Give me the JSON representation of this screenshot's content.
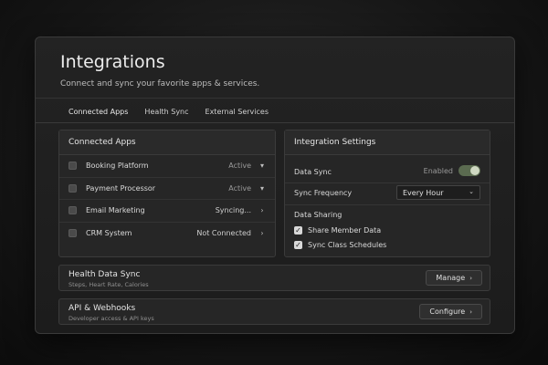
{
  "header": {
    "title": "Integrations",
    "subtitle": "Connect and sync your favorite apps & services."
  },
  "tabs": [
    {
      "label": "Connected Apps",
      "active": true
    },
    {
      "label": "Health Sync",
      "active": false
    },
    {
      "label": "External Services",
      "active": false
    }
  ],
  "connected_apps": {
    "title": "Connected Apps",
    "items": [
      {
        "name": "Booking Platform",
        "status": "Active",
        "icon": "calendar-icon",
        "arrow": "▾"
      },
      {
        "name": "Payment Processor",
        "status": "Active",
        "icon": "card-icon",
        "arrow": "▾"
      },
      {
        "name": "Email Marketing",
        "status": "Syncing...",
        "icon": "mail-icon",
        "arrow": "›"
      },
      {
        "name": "CRM System",
        "status": "Not Connected",
        "icon": "database-icon",
        "arrow": "›"
      }
    ]
  },
  "settings": {
    "title": "Integration Settings",
    "data_sync_label": "Data Sync",
    "data_sync_state": "Enabled",
    "data_sync_on": true,
    "frequency_label": "Sync Frequency",
    "frequency_value": "Every Hour",
    "sharing_label": "Data Sharing",
    "share_member_label": "Share Member Data",
    "share_member_checked": true,
    "sync_class_label": "Sync Class Schedules",
    "sync_class_checked": true
  },
  "health_sync": {
    "title": "Health Data Sync",
    "subtitle": "Steps, Heart Rate, Calories",
    "button": "Manage"
  },
  "api": {
    "title": "API & Webhooks",
    "subtitle": "Developer access & API keys",
    "button": "Configure"
  },
  "colors": {
    "toggle_on": "#5b6b50",
    "background": "#161616"
  }
}
